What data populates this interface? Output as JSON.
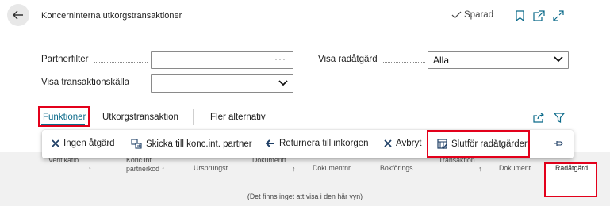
{
  "header": {
    "back_label": "Back",
    "title": "Koncerninterna utkorgstransaktioner",
    "saved_label": "Sparad"
  },
  "filters": {
    "partnerfilter_label": "Partnerfilter",
    "partnerfilter_value": "",
    "radatgard_label": "Visa radåtgärd",
    "radatgard_value": "Alla",
    "kalla_label": "Visa transaktionskälla",
    "kalla_value": ""
  },
  "tabs": {
    "funktioner": "Funktioner",
    "utkorg": "Utkorgstransaktion",
    "fler": "Fler alternativ"
  },
  "menu": {
    "items": [
      {
        "label": "Ingen åtgärd",
        "icon": "x-icon"
      },
      {
        "label": "Skicka till konc.int. partner",
        "icon": "send-icon"
      },
      {
        "label": "Returnera till inkorgen",
        "icon": "arrow-left-icon"
      },
      {
        "label": "Avbryt",
        "icon": "x-icon"
      },
      {
        "label": "Slutför radåtgärder",
        "icon": "finish-icon"
      }
    ]
  },
  "columns": {
    "c1a": "Verifikatio...",
    "c1b": "↑",
    "c2a": "Konc.int.",
    "c2b": "partnerkod ↑",
    "c3": "Ursprungst...",
    "c4a": "Dokumentt...",
    "c4b": "↑",
    "c5": "Dokumentnr",
    "c6": "Bokförings...",
    "c7a": "Transaktion...",
    "c7b": "↑",
    "c8": "Dokument...",
    "c9": "Radåtgärd"
  },
  "empty_message": "(Det finns inget att visa i den här vyn)",
  "colors": {
    "accent": "#0b6a8a",
    "highlight": "#e3001b",
    "list_background": "#f1f1f1"
  }
}
